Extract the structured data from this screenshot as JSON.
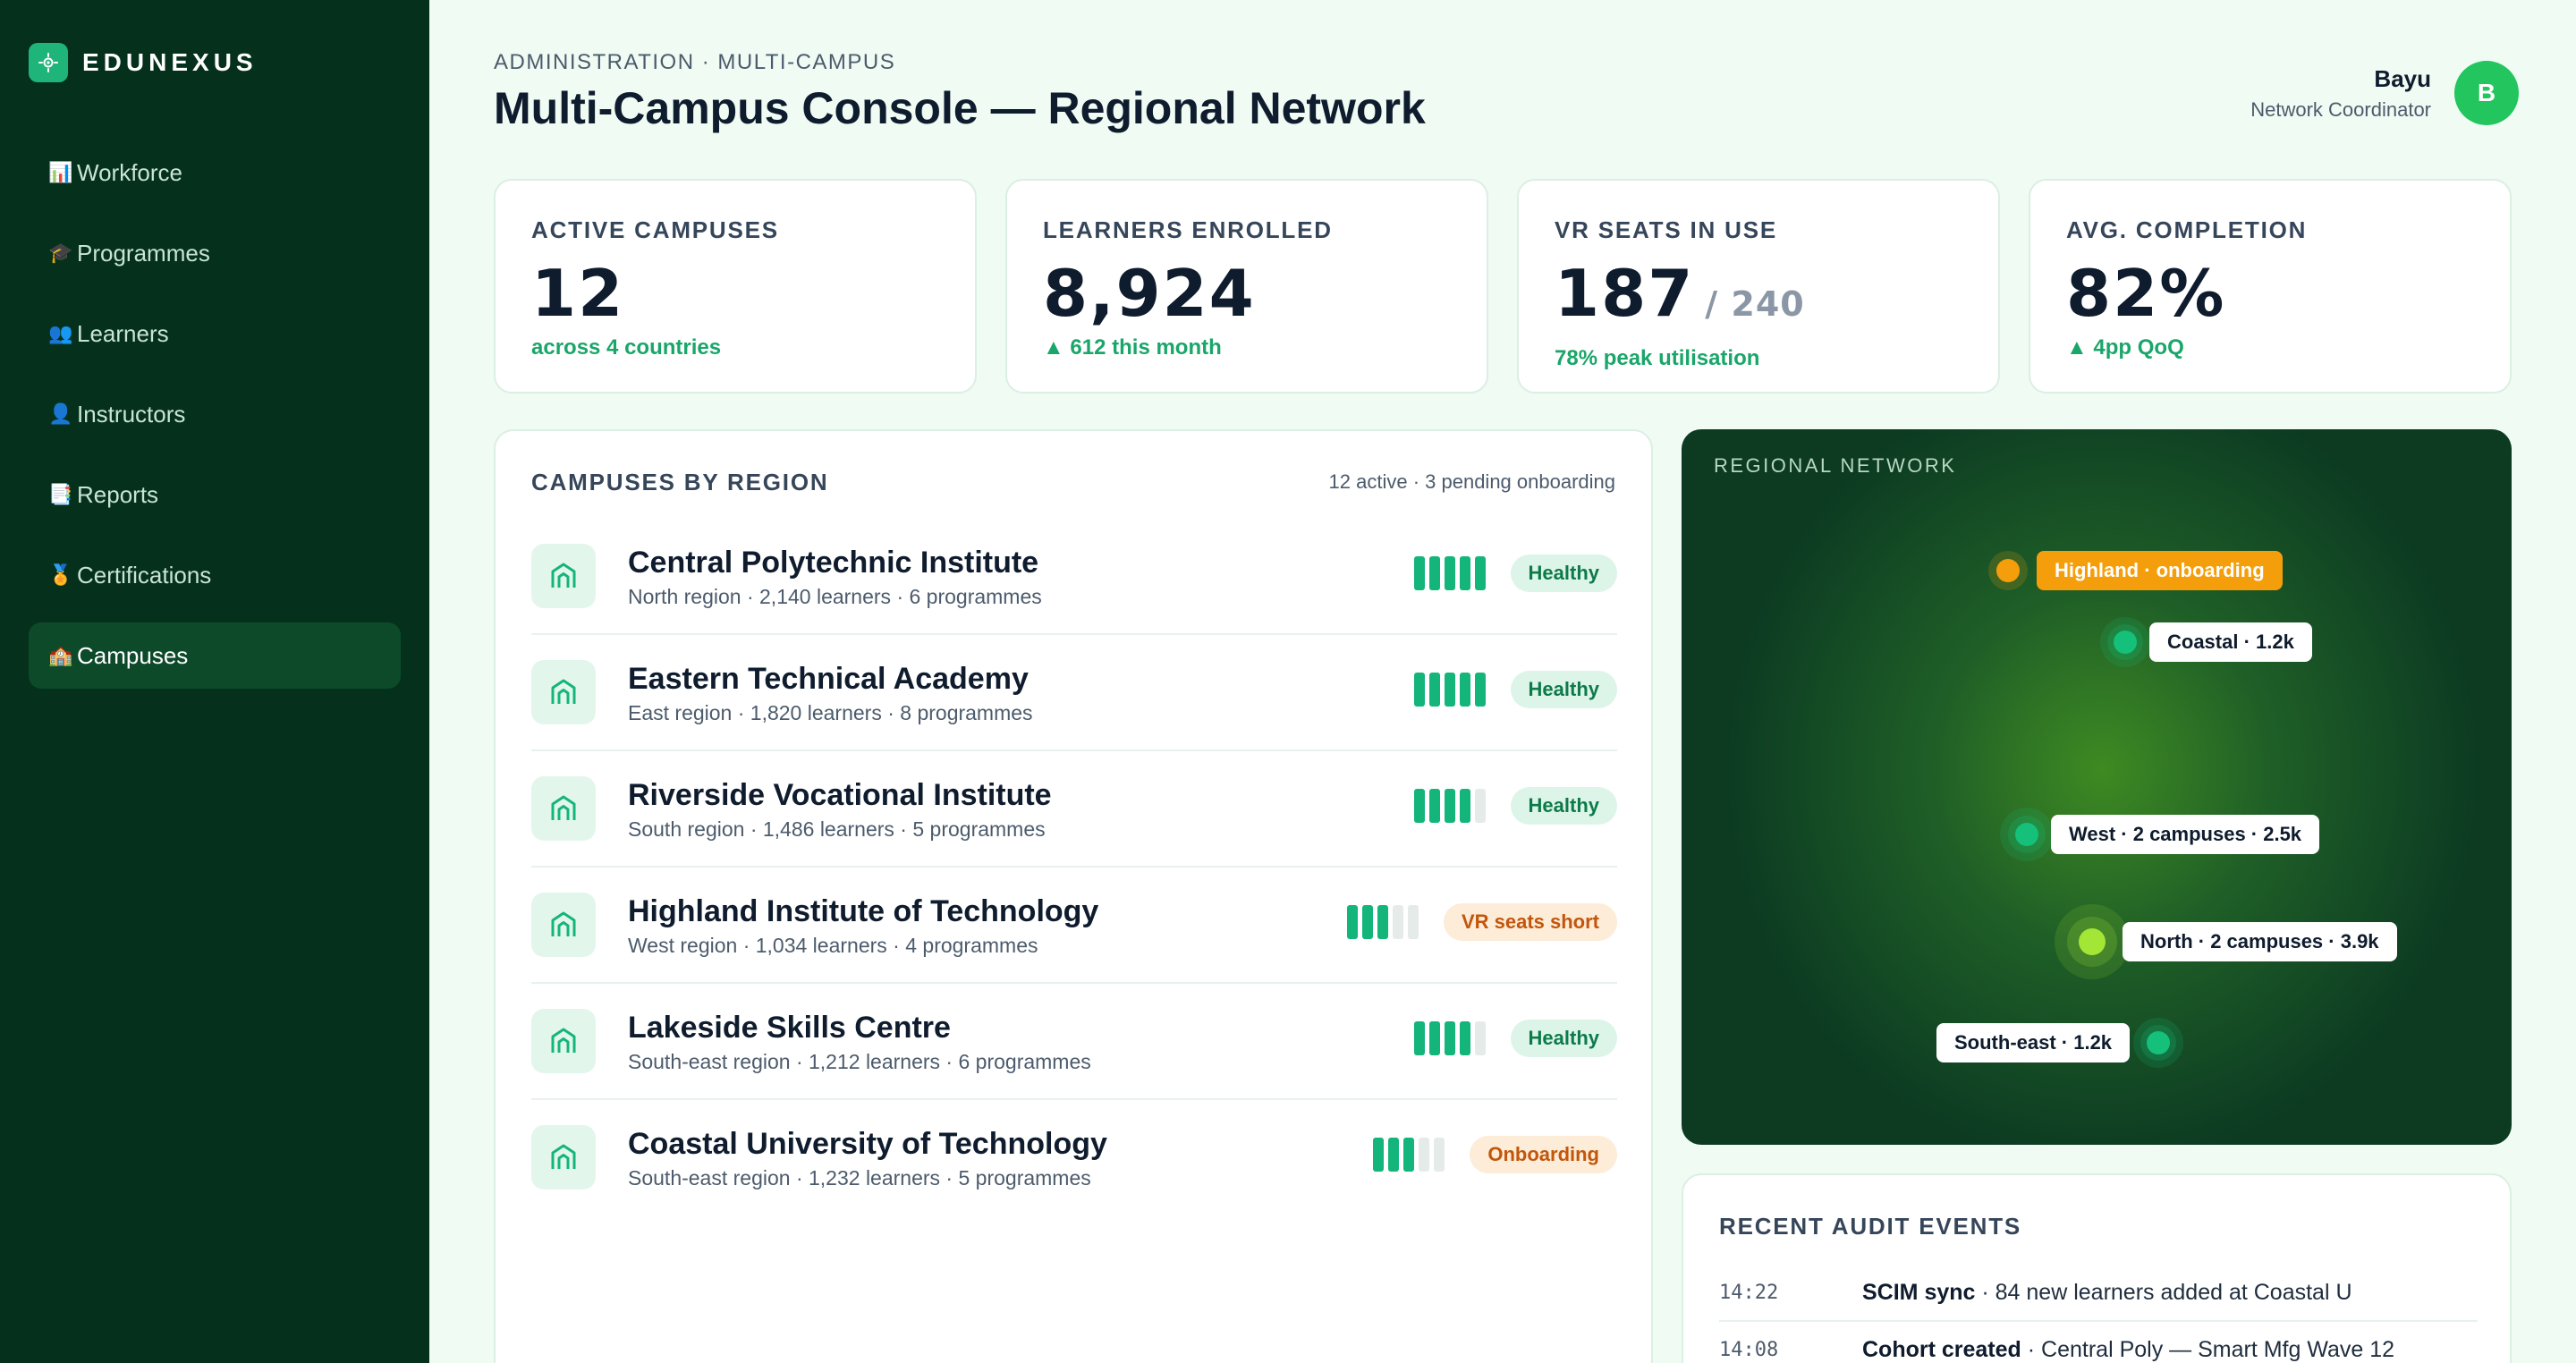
{
  "brand": {
    "name": "EDUNEXUS"
  },
  "nav": [
    {
      "icon": "📊",
      "label": "Workforce",
      "active": false
    },
    {
      "icon": "🎓",
      "label": "Programmes",
      "active": false
    },
    {
      "icon": "👥",
      "label": "Learners",
      "active": false
    },
    {
      "icon": "👤",
      "label": "Instructors",
      "active": false
    },
    {
      "icon": "📑",
      "label": "Reports",
      "active": false
    },
    {
      "icon": "🏅",
      "label": "Certifications",
      "active": false
    },
    {
      "icon": "🏫",
      "label": "Campuses",
      "active": true
    }
  ],
  "header": {
    "breadcrumb": "ADMINISTRATION · MULTI-CAMPUS",
    "title": "Multi-Campus Console — Regional Network"
  },
  "user": {
    "name": "Bayu",
    "role": "Network Coordinator",
    "initial": "B"
  },
  "stats": [
    {
      "label": "ACTIVE CAMPUSES",
      "value": "12",
      "suffix": "",
      "sub": "across 4 countries"
    },
    {
      "label": "LEARNERS ENROLLED",
      "value": "8,924",
      "suffix": "",
      "sub": "▲ 612 this month"
    },
    {
      "label": "VR SEATS IN USE",
      "value": "187",
      "suffix": "/ 240",
      "sub": "78% peak utilisation"
    },
    {
      "label": "AVG. COMPLETION",
      "value": "82%",
      "suffix": "",
      "sub": "▲ 4pp QoQ"
    }
  ],
  "campuses": {
    "title": "CAMPUSES BY REGION",
    "meta": "12 active · 3 pending onboarding",
    "items": [
      {
        "name": "Central Polytechnic Institute",
        "sub": "North region · 2,140 learners · 6 programmes",
        "level": 5,
        "status": "Healthy",
        "status_type": "healthy"
      },
      {
        "name": "Eastern Technical Academy",
        "sub": "East region · 1,820 learners · 8 programmes",
        "level": 5,
        "status": "Healthy",
        "status_type": "healthy"
      },
      {
        "name": "Riverside Vocational Institute",
        "sub": "South region · 1,486 learners · 5 programmes",
        "level": 4,
        "status": "Healthy",
        "status_type": "healthy"
      },
      {
        "name": "Highland Institute of Technology",
        "sub": "West region · 1,034 learners · 4 programmes",
        "level": 3,
        "status": "VR seats short",
        "status_type": "warn"
      },
      {
        "name": "Lakeside Skills Centre",
        "sub": "South-east region · 1,212 learners · 6 programmes",
        "level": 4,
        "status": "Healthy",
        "status_type": "healthy"
      },
      {
        "name": "Coastal University of Technology",
        "sub": "South-east region · 1,232 learners · 5 programmes",
        "level": 3,
        "status": "Onboarding",
        "status_type": "warn"
      }
    ]
  },
  "map": {
    "title": "REGIONAL NETWORK",
    "labels": {
      "highland": "Highland · onboarding",
      "coastal": "Coastal · 1.2k",
      "west": "West · 2 campuses · 2.5k",
      "north": "North · 2 campuses · 3.9k",
      "southeast": "South-east · 1.2k"
    },
    "colors": {
      "dot_green": "#14c07a",
      "dot_lime": "#a3e635",
      "dot_orange": "#f59e0b"
    }
  },
  "audit": {
    "title": "RECENT AUDIT EVENTS",
    "items": [
      {
        "time": "14:22",
        "event": "SCIM sync",
        "detail": " · 84 new learners added at Coastal U"
      },
      {
        "time": "14:08",
        "event": "Cohort created",
        "detail": " · Central Poly — Smart Mfg Wave 12"
      }
    ]
  }
}
